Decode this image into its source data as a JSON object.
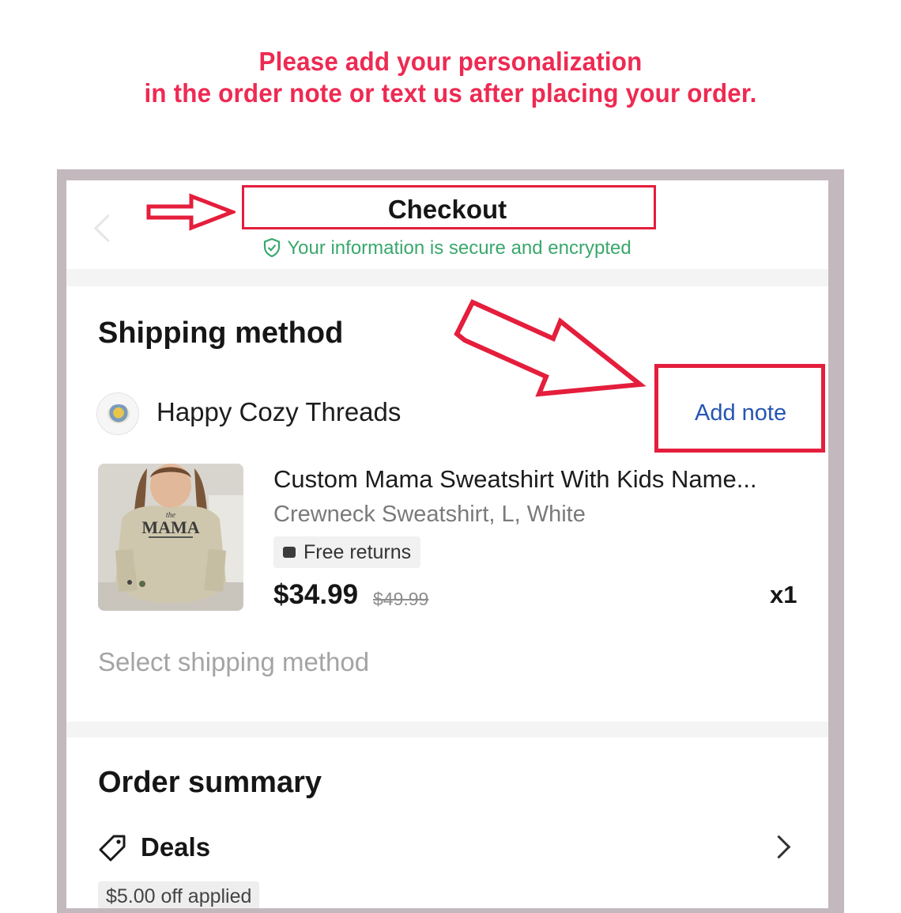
{
  "banner": {
    "line1": "Please add your personalization",
    "line2": "in the order note or text us after placing your order."
  },
  "header": {
    "title": "Checkout",
    "secure_text": "Your information is secure and encrypted"
  },
  "shipping": {
    "section_title": "Shipping method",
    "shop_name": "Happy Cozy Threads",
    "add_note_label": "Add note",
    "product": {
      "name": "Custom Mama Sweatshirt With Kids Name...",
      "variant": "Crewneck Sweatshirt, L, White",
      "badge": "Free returns",
      "price": "$34.99",
      "original_price": "$49.99",
      "quantity": "x1",
      "image_text": "MAMA"
    },
    "select_method_label": "Select shipping method"
  },
  "summary": {
    "section_title": "Order summary",
    "deals_label": "Deals",
    "deal_badge": "$5.00 off applied"
  },
  "colors": {
    "banner_red": "#ee2a52",
    "highlight_red": "#e41e3c",
    "secure_green": "#3aa76d",
    "link_blue": "#2555b3"
  },
  "icons": [
    "back-chevron-icon",
    "shield-check-icon",
    "shop-logo",
    "return-box-icon",
    "tag-icon",
    "chevron-right-icon",
    "arrow-annotation"
  ]
}
